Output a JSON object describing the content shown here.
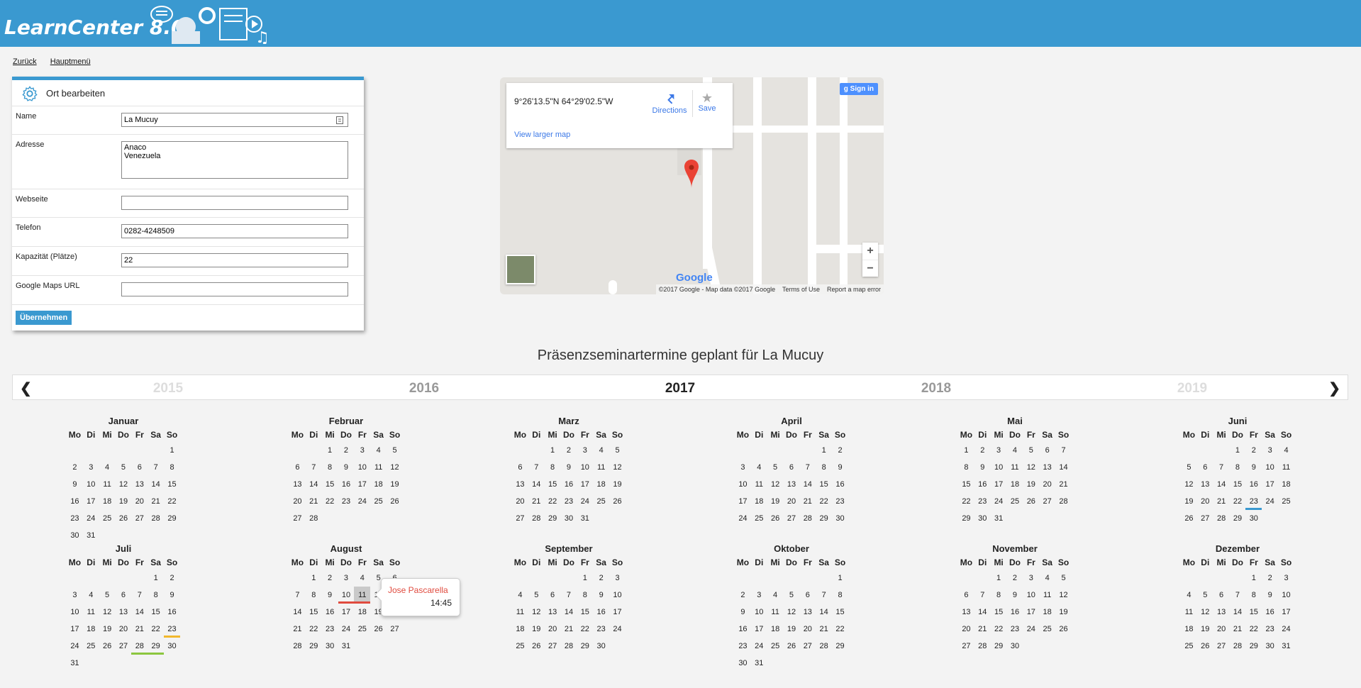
{
  "app": {
    "logo": "LearnCenter 8.0"
  },
  "nav": {
    "back": "Zurück",
    "main_menu": "Hauptmenü"
  },
  "form": {
    "title": "Ort bearbeiten",
    "name_label": "Name",
    "name_value": "La Mucuy",
    "address_label": "Adresse",
    "address_value": "Anaco\nVenezuela",
    "website_label": "Webseite",
    "website_value": "",
    "phone_label": "Telefon",
    "phone_value": "0282-4248509",
    "capacity_label": "Kapazität (Plätze)",
    "capacity_value": "22",
    "maps_label": "Google Maps URL",
    "maps_value": "",
    "apply_button": "Übernehmen"
  },
  "map": {
    "coords": "9°26'13.5\"N 64°29'02.5\"W",
    "directions": "Directions",
    "save": "Save",
    "view_larger": "View larger map",
    "sign_in": "Sign in",
    "zoom_in": "+",
    "zoom_out": "−",
    "copyright": "©2017 Google - Map data ©2017 Google",
    "terms": "Terms of Use",
    "report": "Report a map error",
    "watermark": "Google"
  },
  "calendar": {
    "title": "Präsenzseminartermine geplant für La Mucuy",
    "years": [
      "2015",
      "2016",
      "2017",
      "2018",
      "2019"
    ],
    "current_year": "2017",
    "weekdays": [
      "Mo",
      "Di",
      "Mi",
      "Do",
      "Fr",
      "Sa",
      "So"
    ],
    "months": [
      {
        "name": "Januar",
        "offset": 6,
        "days": 31
      },
      {
        "name": "Februar",
        "offset": 2,
        "days": 28
      },
      {
        "name": "Marz",
        "offset": 2,
        "days": 31
      },
      {
        "name": "April",
        "offset": 5,
        "days": 30
      },
      {
        "name": "Mai",
        "offset": 0,
        "days": 31
      },
      {
        "name": "Juni",
        "offset": 3,
        "days": 30
      },
      {
        "name": "Juli",
        "offset": 5,
        "days": 31
      },
      {
        "name": "August",
        "offset": 1,
        "days": 31
      },
      {
        "name": "September",
        "offset": 4,
        "days": 30
      },
      {
        "name": "Oktober",
        "offset": 6,
        "days": 31
      },
      {
        "name": "November",
        "offset": 2,
        "days": 30
      },
      {
        "name": "Dezember",
        "offset": 4,
        "days": 31
      }
    ],
    "marks": [
      {
        "month": 5,
        "day": 23,
        "color": "#3a99d0"
      },
      {
        "month": 6,
        "day": 23,
        "color": "#f1b82d"
      },
      {
        "month": 6,
        "day": 28,
        "color": "#8cc63f"
      },
      {
        "month": 6,
        "day": 29,
        "color": "#8cc63f"
      },
      {
        "month": 7,
        "day": 10,
        "color": "#e04b3f"
      },
      {
        "month": 7,
        "day": 11,
        "color": "#e04b3f"
      }
    ],
    "selected": {
      "month": 7,
      "day": 11
    },
    "tooltip": {
      "name": "Jose Pascarella",
      "time": "14:45"
    }
  }
}
